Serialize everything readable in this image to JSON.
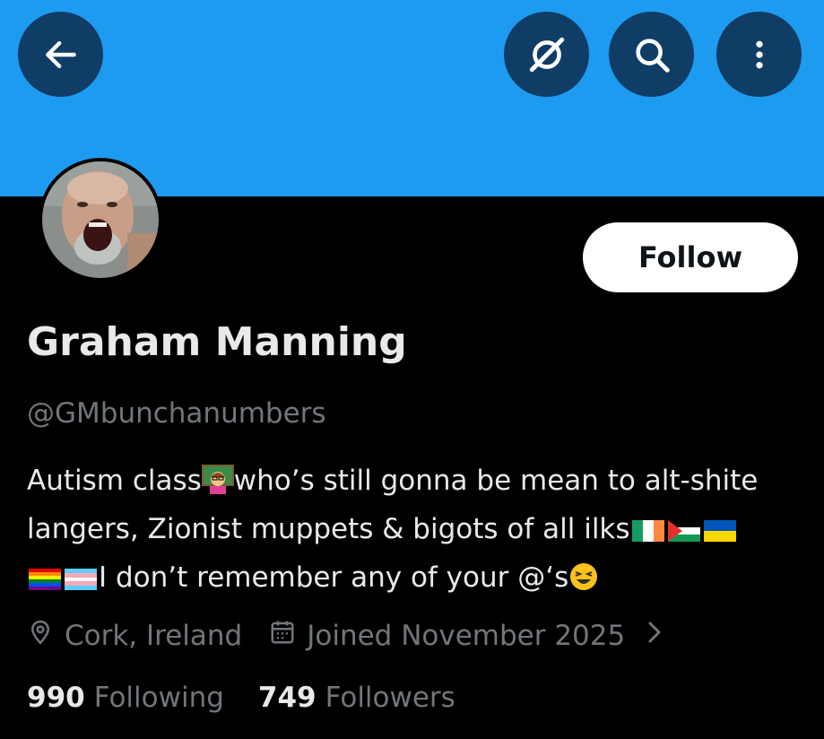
{
  "colors": {
    "banner": "#1d9bf0",
    "header_button_bg": "#0f3d66",
    "background": "#000000",
    "text_primary": "#e7e9ea",
    "text_secondary": "#71767b",
    "follow_bg": "#ffffff",
    "follow_text": "#0f1419"
  },
  "header": {
    "icons": [
      "back-arrow-icon",
      "grok-icon",
      "search-icon",
      "more-vertical-icon"
    ]
  },
  "profile": {
    "name": "Graham Manning",
    "handle": "@GMbunchanumbers",
    "follow_label": "Follow",
    "bio": {
      "line1_a": "Autism class",
      "line1_b": "who’s still gonna be mean to alt-shite",
      "line2": "langers, Zionist muppets & bigots of all ilks",
      "line3": "I don’t remember any of your @‘s"
    },
    "location": "Cork, Ireland",
    "joined": "Joined November 2025",
    "following_count": "990",
    "following_label": "Following",
    "followers_count": "749",
    "followers_label": "Followers"
  }
}
